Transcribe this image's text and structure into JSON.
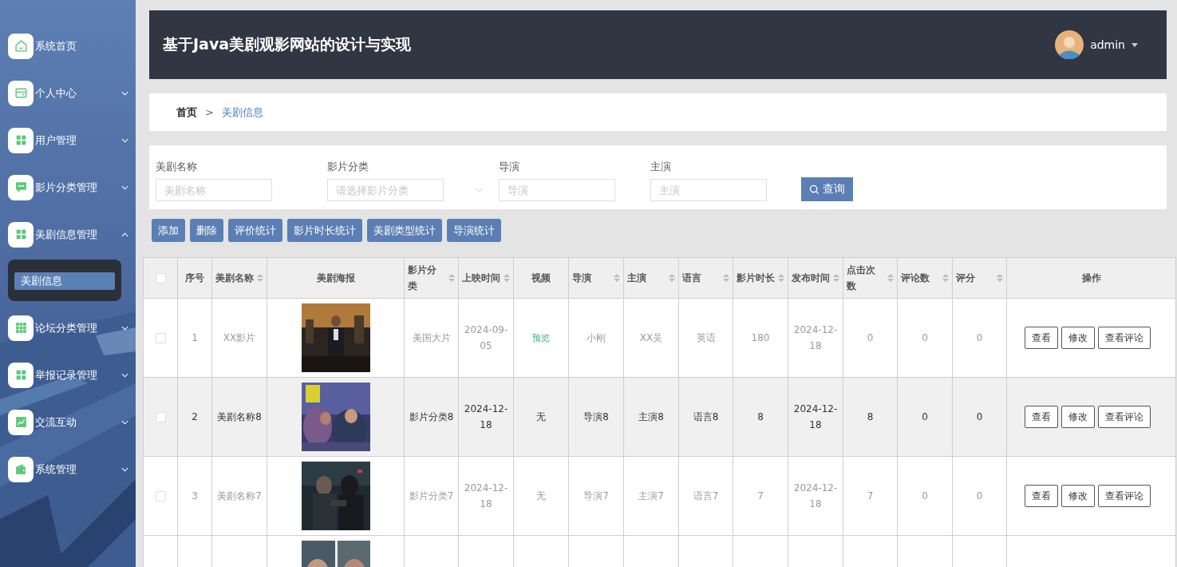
{
  "sidebar": {
    "items": [
      {
        "label": "系统首页",
        "expandable": false
      },
      {
        "label": "个人中心",
        "expandable": true,
        "expanded": false
      },
      {
        "label": "用户管理",
        "expandable": true,
        "expanded": false
      },
      {
        "label": "影片分类管理",
        "expandable": true,
        "expanded": false
      },
      {
        "label": "美剧信息管理",
        "expandable": true,
        "expanded": true,
        "children": [
          {
            "label": "美剧信息",
            "selected": true
          }
        ]
      },
      {
        "label": "论坛分类管理",
        "expandable": true,
        "expanded": false
      },
      {
        "label": "举报记录管理",
        "expandable": true,
        "expanded": false
      },
      {
        "label": "交流互动",
        "expandable": true,
        "expanded": false
      },
      {
        "label": "系统管理",
        "expandable": true,
        "expanded": false
      }
    ]
  },
  "header": {
    "title": "基于Java美剧观影网站的设计与实现",
    "user": "admin"
  },
  "breadcrumb": [
    "首页",
    ">",
    "美剧信息"
  ],
  "search": {
    "fields": [
      {
        "label": "美剧名称",
        "placeholder": "美剧名称",
        "kind": "input"
      },
      {
        "label": "影片分类",
        "placeholder": "请选择影片分类",
        "kind": "select"
      },
      {
        "label": "导演",
        "placeholder": "导演",
        "kind": "input"
      },
      {
        "label": "主演",
        "placeholder": "主演",
        "kind": "input"
      }
    ],
    "button": "查询"
  },
  "toolbar": [
    "添加",
    "删除",
    "评价统计",
    "影片时长统计",
    "美剧类型统计",
    "导演统计"
  ],
  "table": {
    "header_checked": false,
    "columns": [
      {
        "label": "序号",
        "sortable": false
      },
      {
        "label": "美剧名称",
        "sortable": true
      },
      {
        "label": "美剧海报",
        "sortable": false
      },
      {
        "label": "影片分类",
        "sortable": true
      },
      {
        "label": "上映时间",
        "sortable": true
      },
      {
        "label": "视频",
        "sortable": false
      },
      {
        "label": "导演",
        "sortable": true
      },
      {
        "label": "主演",
        "sortable": true
      },
      {
        "label": "语言",
        "sortable": true
      },
      {
        "label": "影片时长",
        "sortable": true
      },
      {
        "label": "发布时间",
        "sortable": true
      },
      {
        "label": "点击次数",
        "sortable": true
      },
      {
        "label": "评论数",
        "sortable": true
      },
      {
        "label": "评分",
        "sortable": true
      },
      {
        "label": "操作",
        "sortable": false
      }
    ],
    "rows": [
      {
        "checked": false,
        "highlighted": false,
        "index": "1",
        "name": "XX影片",
        "poster": {
          "kind": "picture"
        },
        "category": "美国大片",
        "release": "2024-09-05",
        "video": {
          "kind": "link",
          "text": "预览"
        },
        "director": "小刚",
        "actor": "XX吴",
        "language": "英语",
        "duration": "180",
        "published": "2024-12-18",
        "clicks": "0",
        "comments": "0",
        "rating": "0",
        "actions": [
          "查看",
          "修改",
          "查看评论"
        ]
      },
      {
        "checked": false,
        "highlighted": true,
        "index": "2",
        "name": "美剧名称8",
        "poster": {
          "kind": "picture"
        },
        "category": "影片分类8",
        "release": "2024-12-18",
        "video": {
          "kind": "text",
          "text": "无"
        },
        "director": "导演8",
        "actor": "主演8",
        "language": "语言8",
        "duration": "8",
        "published": "2024-12-18",
        "clicks": "8",
        "comments": "0",
        "rating": "0",
        "actions": [
          "查看",
          "修改",
          "查看评论"
        ]
      },
      {
        "checked": false,
        "highlighted": false,
        "index": "3",
        "name": "美剧名称7",
        "poster": {
          "kind": "picture"
        },
        "category": "影片分类7",
        "release": "2024-12-18",
        "video": {
          "kind": "text",
          "text": "无"
        },
        "director": "导演7",
        "actor": "主演7",
        "language": "语言7",
        "duration": "7",
        "published": "2024-12-18",
        "clicks": "7",
        "comments": "0",
        "rating": "0",
        "actions": [
          "查看",
          "修改",
          "查看评论"
        ]
      },
      {
        "poster": {
          "kind": "picture"
        }
      }
    ]
  }
}
